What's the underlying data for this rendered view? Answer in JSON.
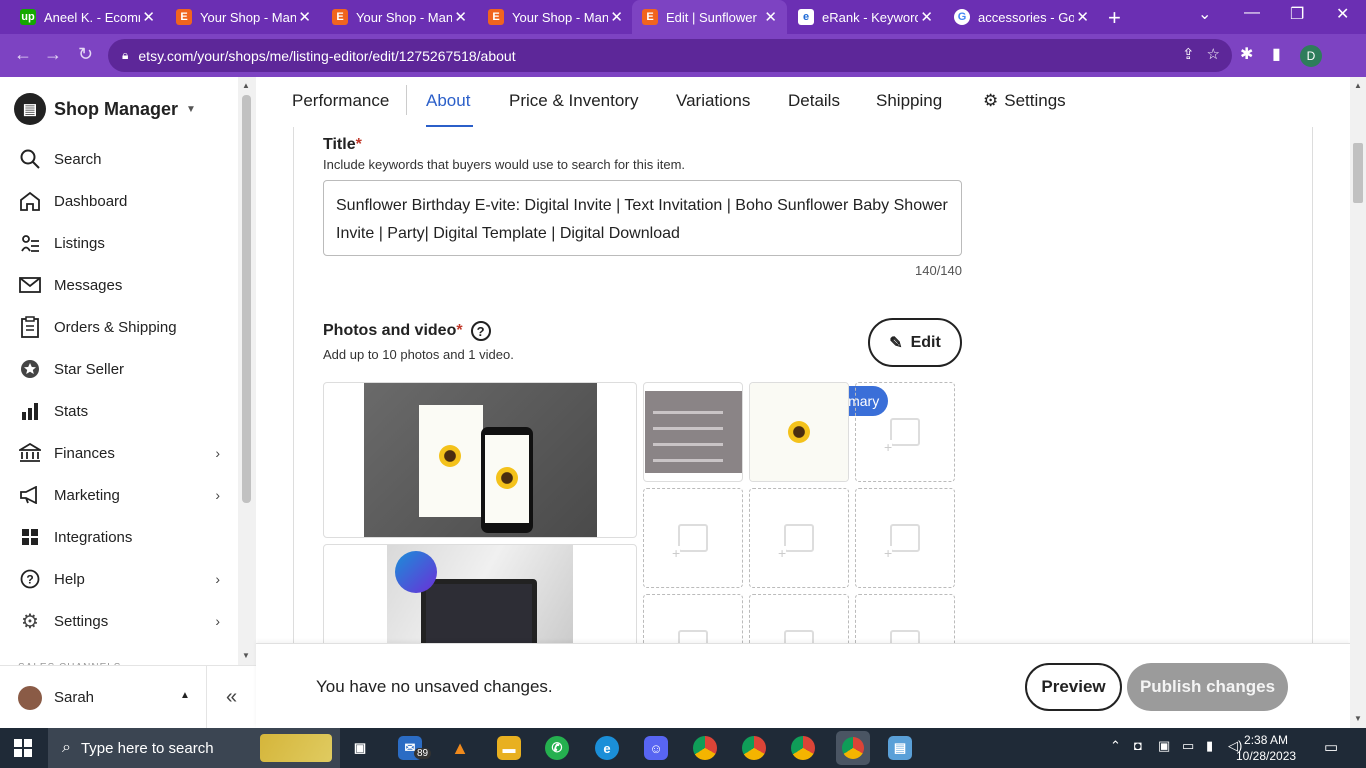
{
  "browser": {
    "tabs": [
      {
        "title": "Aneel K. - Ecomm",
        "favicon": "upwork-icon",
        "active": false
      },
      {
        "title": "Your Shop - Man",
        "favicon": "etsy-icon",
        "active": false
      },
      {
        "title": "Your Shop - Man",
        "favicon": "etsy-icon",
        "active": false
      },
      {
        "title": "Your Shop - Man",
        "favicon": "etsy-icon",
        "active": false
      },
      {
        "title": "Edit | Sunflower",
        "favicon": "etsy-icon",
        "active": true
      },
      {
        "title": "eRank - Keyword",
        "favicon": "erank-icon",
        "active": false
      },
      {
        "title": "accessories - Go",
        "favicon": "google-icon",
        "active": false
      }
    ],
    "url": "etsy.com/your/shops/me/listing-editor/edit/1275267518/about",
    "profile_initial": "D",
    "accent": "#7d43c2"
  },
  "sidebar": {
    "brand": "Shop Manager",
    "items": [
      {
        "label": "Search",
        "icon": "search-icon"
      },
      {
        "label": "Dashboard",
        "icon": "home-icon"
      },
      {
        "label": "Listings",
        "icon": "listings-icon"
      },
      {
        "label": "Messages",
        "icon": "envelope-icon"
      },
      {
        "label": "Orders & Shipping",
        "icon": "clipboard-icon"
      },
      {
        "label": "Star Seller",
        "icon": "star-badge-icon"
      },
      {
        "label": "Stats",
        "icon": "bar-chart-icon"
      },
      {
        "label": "Finances",
        "icon": "bank-icon"
      },
      {
        "label": "Marketing",
        "icon": "megaphone-icon"
      },
      {
        "label": "Integrations",
        "icon": "grid-icon"
      },
      {
        "label": "Help",
        "icon": "help-icon"
      },
      {
        "label": "Settings",
        "icon": "gear-icon"
      }
    ],
    "section_faded": "SALES CHANNELS",
    "user": "Sarah"
  },
  "tabs_nav": [
    "Performance",
    "About",
    "Price & Inventory",
    "Variations",
    "Details",
    "Shipping",
    "Settings"
  ],
  "title_section": {
    "label": "Title",
    "required": "*",
    "hint": "Include keywords that buyers would use to search for this item.",
    "value": "Sunflower Birthday E-vite: Digital Invite | Text Invitation | Boho Sunflower Baby Shower Invite | Party| Digital Template | Digital Download",
    "counter": "140/140"
  },
  "photos_section": {
    "label": "Photos and video",
    "required": "*",
    "hint": "Add up to 10 photos and 1 video.",
    "edit_label": "Edit",
    "primary_badge": "Primary"
  },
  "footer": {
    "status": "You have no unsaved changes.",
    "preview_label": "Preview",
    "publish_label": "Publish changes"
  },
  "taskbar": {
    "search_placeholder": "Type here to search",
    "mail_badge": "89",
    "time": "2:38 AM",
    "date": "10/28/2023"
  }
}
